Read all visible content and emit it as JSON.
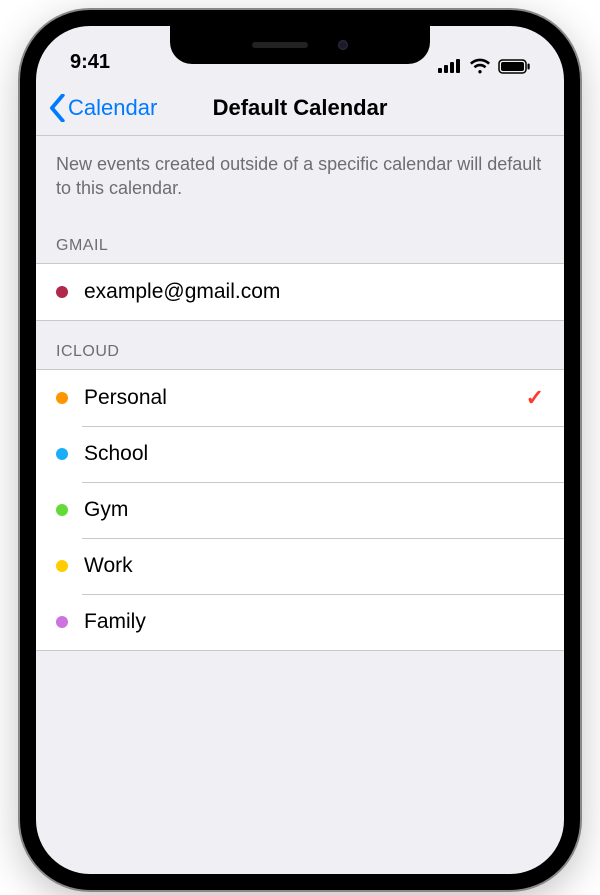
{
  "status": {
    "time": "9:41"
  },
  "nav": {
    "back_label": "Calendar",
    "title": "Default Calendar"
  },
  "description": "New events created outside of a specific calendar will default to this calendar.",
  "sections": {
    "gmail": {
      "header": "GMAIL",
      "items": [
        {
          "label": "example@gmail.com",
          "color": "#b0284c",
          "selected": false
        }
      ]
    },
    "icloud": {
      "header": "ICLOUD",
      "items": [
        {
          "label": "Personal",
          "color": "#ff9500",
          "selected": true
        },
        {
          "label": "School",
          "color": "#1badf8",
          "selected": false
        },
        {
          "label": "Gym",
          "color": "#63da38",
          "selected": false
        },
        {
          "label": "Work",
          "color": "#ffcc00",
          "selected": false
        },
        {
          "label": "Family",
          "color": "#cc73e1",
          "selected": false
        }
      ]
    }
  }
}
